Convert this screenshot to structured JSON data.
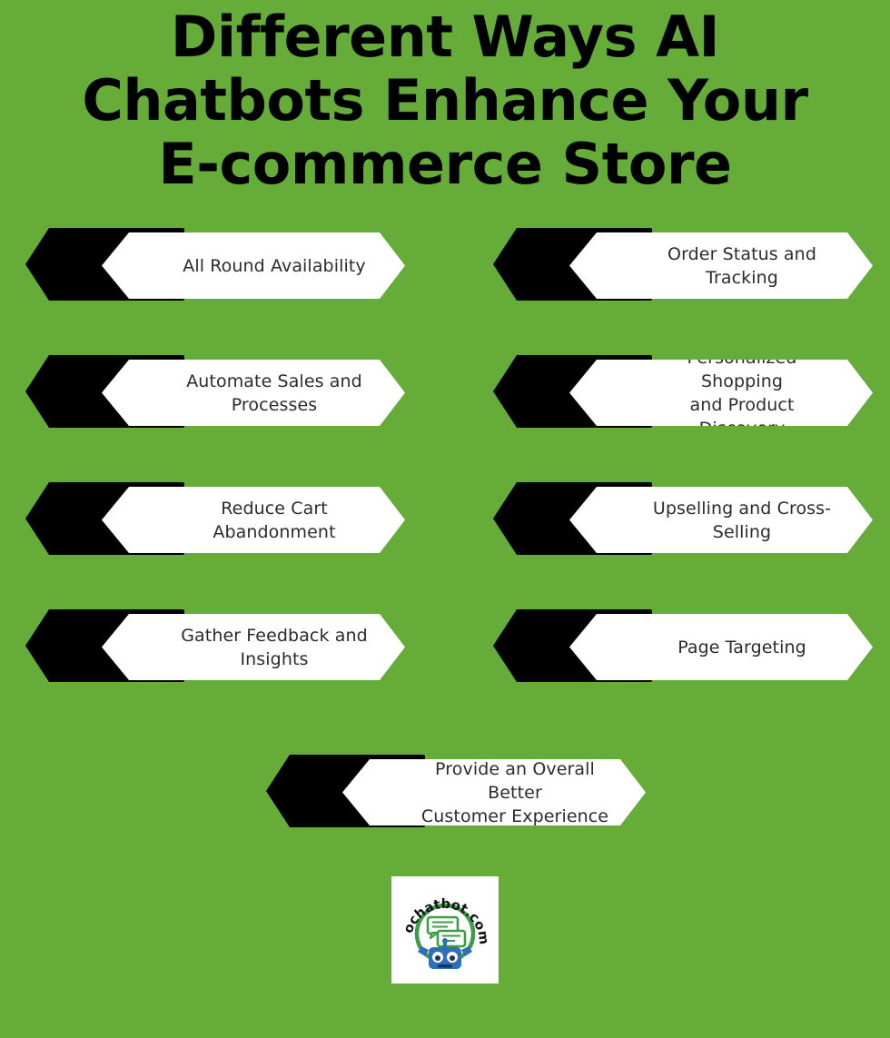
{
  "theme": {
    "background_color": "#65ad38",
    "banner_fill": "#ffffff",
    "chevron_fill": "#000000",
    "text_color": "#2b2b2b",
    "title_color": "#000000",
    "logo_green": "#3a9e46",
    "logo_blue": "#2f6fb7"
  },
  "title": {
    "line1": "Different Ways AI",
    "line2": "Chatbots Enhance Your",
    "line3": "E-commerce Store"
  },
  "banners": [
    {
      "id": "all-round-availability",
      "column": "left",
      "row": 0,
      "line1": "All Round Availability",
      "line2": ""
    },
    {
      "id": "order-status-and-tracking",
      "column": "right",
      "row": 0,
      "line1": "Order Status and",
      "line2": "Tracking"
    },
    {
      "id": "automate-sales-and-processes",
      "column": "left",
      "row": 1,
      "line1": "Automate Sales and",
      "line2": "Processes"
    },
    {
      "id": "personalized-shopping",
      "column": "right",
      "row": 1,
      "line1": "Personalized Shopping",
      "line2": "and Product Discovery"
    },
    {
      "id": "reduce-cart-abandonment",
      "column": "left",
      "row": 2,
      "line1": "Reduce Cart",
      "line2": "Abandonment"
    },
    {
      "id": "upselling-and-cross-selling",
      "column": "right",
      "row": 2,
      "line1": "Upselling and Cross-",
      "line2": "Selling"
    },
    {
      "id": "gather-feedback-and-insights",
      "column": "left",
      "row": 3,
      "line1": "Gather Feedback and",
      "line2": "Insights"
    },
    {
      "id": "page-targeting",
      "column": "right",
      "row": 3,
      "line1": "Page Targeting",
      "line2": ""
    },
    {
      "id": "better-customer-experience",
      "column": "center",
      "row": 4,
      "line1": "Provide an Overall Better",
      "line2": "Customer Experience"
    }
  ],
  "logo": {
    "brand": "ochatbot.com",
    "icon_name": "chatbot-robot-icon"
  }
}
